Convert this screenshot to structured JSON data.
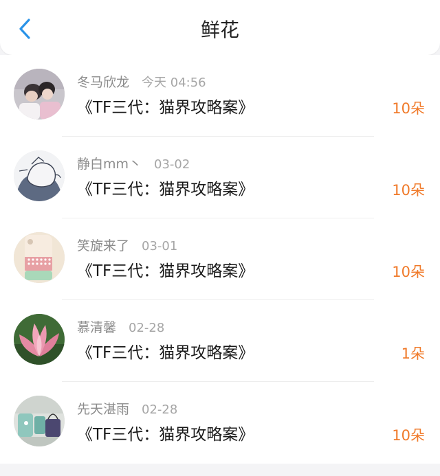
{
  "header": {
    "title": "鲜花",
    "back_icon": "chevron-left-icon",
    "accent": "#2a93e8"
  },
  "colors": {
    "amount": "#f07a2a",
    "name": "#8c8c8c",
    "title": "#1a1a1a"
  },
  "items": [
    {
      "name": "冬马欣龙",
      "time": "今天 04:56",
      "title": "《TF三代：猫界攻略案》",
      "amount": "10朵",
      "avatar": "avatar-photo-couple"
    },
    {
      "name": "静白mm丶",
      "time": "03-02",
      "title": "《TF三代：猫界攻略案》",
      "amount": "10朵",
      "avatar": "avatar-sketch-figure"
    },
    {
      "name": "笑旋来了",
      "time": "03-01",
      "title": "《TF三代：猫界攻略案》",
      "amount": "10朵",
      "avatar": "avatar-pastel-case"
    },
    {
      "name": "慕清馨",
      "time": "02-28",
      "title": "《TF三代：猫界攻略案》",
      "amount": "1朵",
      "avatar": "avatar-lotus-flower"
    },
    {
      "name": "先天湛雨",
      "time": "02-28",
      "title": "《TF三代：猫界攻略案》",
      "amount": "10朵",
      "avatar": "avatar-teal-objects"
    }
  ]
}
